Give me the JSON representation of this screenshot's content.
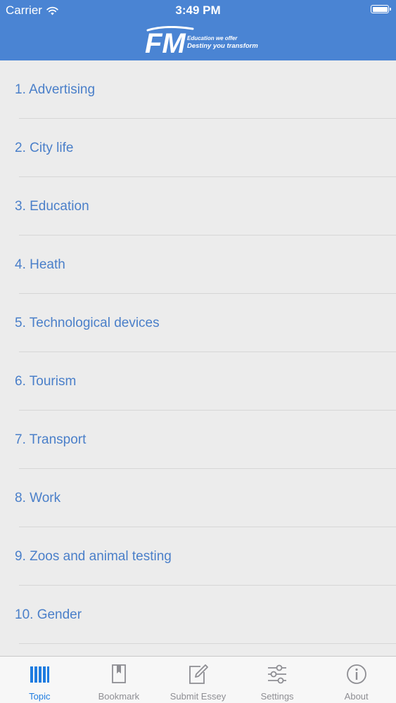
{
  "status_bar": {
    "carrier": "Carrier",
    "time": "3:49 PM",
    "battery_level": 1.0
  },
  "header": {
    "logo_letters": "FM",
    "tagline_line1": "Education we offer",
    "tagline_line2": "Destiny you transform",
    "background_color": "#4a84d3"
  },
  "topics": [
    {
      "label": "1. Advertising"
    },
    {
      "label": "2. City life"
    },
    {
      "label": "3. Education"
    },
    {
      "label": "4. Heath"
    },
    {
      "label": "5. Technological devices"
    },
    {
      "label": "6. Tourism"
    },
    {
      "label": "7. Transport"
    },
    {
      "label": "8. Work"
    },
    {
      "label": "9. Zoos and animal testing"
    },
    {
      "label": "10. Gender"
    }
  ],
  "tab_bar": {
    "active_color": "#1f7ce0",
    "inactive_color": "#8e8e93",
    "tabs": [
      {
        "label": "Topic",
        "icon": "library-books-icon",
        "active": true
      },
      {
        "label": "Bookmark",
        "icon": "bookmark-icon",
        "active": false
      },
      {
        "label": "Submit Essey",
        "icon": "compose-icon",
        "active": false
      },
      {
        "label": "Settings",
        "icon": "sliders-icon",
        "active": false
      },
      {
        "label": "About",
        "icon": "info-icon",
        "active": false
      }
    ]
  }
}
